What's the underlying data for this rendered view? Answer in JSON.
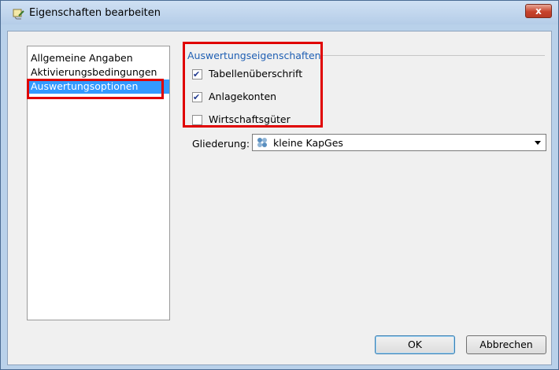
{
  "window": {
    "title": "Eigenschaften bearbeiten",
    "close_label": "x"
  },
  "nav": {
    "items": [
      {
        "label": "Allgemeine Angaben",
        "selected": false
      },
      {
        "label": "Aktivierungsbedingungen",
        "selected": false
      },
      {
        "label": "Auswertungsoptionen",
        "selected": true
      }
    ]
  },
  "group": {
    "title": "Auswertungseigenschaften",
    "options": [
      {
        "label": "Tabellenüberschrift",
        "checked": true
      },
      {
        "label": "Anlagekonten",
        "checked": true
      },
      {
        "label": "Wirtschaftsgüter",
        "checked": false
      }
    ]
  },
  "gliederung": {
    "label": "Gliederung:",
    "value": "kleine KapGes",
    "icon": "puzzle-icon"
  },
  "buttons": {
    "ok": "OK",
    "cancel": "Abbrechen"
  },
  "colors": {
    "selection": "#3399ff",
    "highlight": "#e00000",
    "group_title": "#1f5fb3"
  }
}
